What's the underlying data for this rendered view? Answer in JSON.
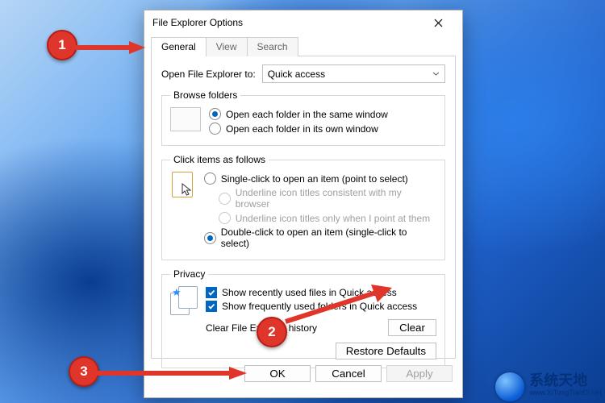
{
  "window": {
    "title": "File Explorer Options"
  },
  "tabs": {
    "general": "General",
    "view": "View",
    "search": "Search"
  },
  "open": {
    "label": "Open File Explorer to:",
    "value": "Quick access"
  },
  "browse": {
    "legend": "Browse folders",
    "same": "Open each folder in the same window",
    "own": "Open each folder in its own window"
  },
  "click": {
    "legend": "Click items as follows",
    "single": "Single-click to open an item (point to select)",
    "u1": "Underline icon titles consistent with my browser",
    "u2": "Underline icon titles only when I point at them",
    "double": "Double-click to open an item (single-click to select)"
  },
  "privacy": {
    "legend": "Privacy",
    "recent": "Show recently used files in Quick access",
    "frequent": "Show frequently used folders in Quick access",
    "clearLabel": "Clear File Explorer history",
    "clearBtn": "Clear",
    "restore": "Restore Defaults"
  },
  "footer": {
    "ok": "OK",
    "cancel": "Cancel",
    "apply": "Apply"
  },
  "annot": {
    "c1": "1",
    "c2": "2",
    "c3": "3"
  },
  "watermark": {
    "main": "系统天地",
    "sub": "www.XiTongTianDi.net"
  }
}
